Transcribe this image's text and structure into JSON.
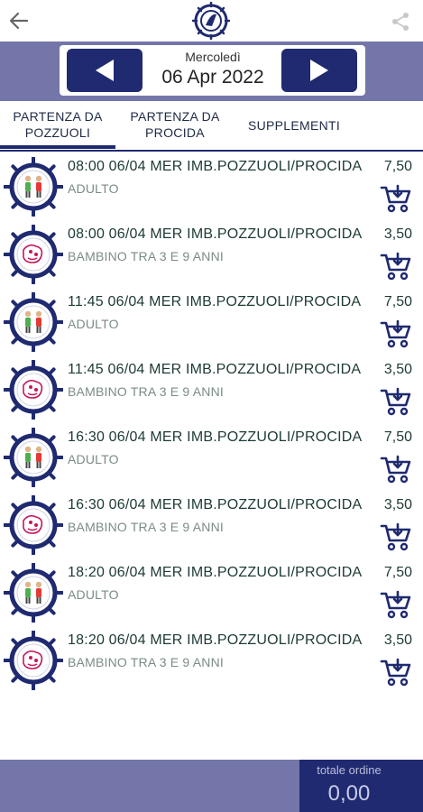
{
  "header": {
    "back_icon": "arrow-left-icon",
    "logo": "ferry-company-logo",
    "share_icon": "share-icon"
  },
  "date_nav": {
    "day_name": "Mercoledì",
    "date": "06 Apr 2022",
    "prev_icon": "triangle-left-icon",
    "next_icon": "triangle-right-icon"
  },
  "tabs": [
    {
      "line1": "PARTENZA DA",
      "line2": "POZZUOLI",
      "selected": true
    },
    {
      "line1": "PARTENZA DA",
      "line2": "PROCIDA",
      "selected": false
    },
    {
      "line1": "SUPPLEMENTI",
      "line2": "",
      "selected": false
    }
  ],
  "tickets": [
    {
      "title": "08:00 06/04 MER IMB.POZZUOLI/PROCIDA",
      "type": "ADULTO",
      "price": "7,50",
      "icon": "adult-ticket-icon"
    },
    {
      "title": "08:00 06/04 MER IMB.POZZUOLI/PROCIDA",
      "type": "BAMBINO TRA 3 E 9 ANNI",
      "price": "3,50",
      "icon": "child-ticket-icon"
    },
    {
      "title": "11:45 06/04 MER IMB.POZZUOLI/PROCIDA",
      "type": "ADULTO",
      "price": "7,50",
      "icon": "adult-ticket-icon"
    },
    {
      "title": "11:45 06/04 MER IMB.POZZUOLI/PROCIDA",
      "type": "BAMBINO TRA 3 E 9 ANNI",
      "price": "3,50",
      "icon": "child-ticket-icon"
    },
    {
      "title": "16:30 06/04 MER IMB.POZZUOLI/PROCIDA",
      "type": "ADULTO",
      "price": "7,50",
      "icon": "adult-ticket-icon"
    },
    {
      "title": "16:30 06/04 MER IMB.POZZUOLI/PROCIDA",
      "type": "BAMBINO TRA 3 E 9 ANNI",
      "price": "3,50",
      "icon": "child-ticket-icon"
    },
    {
      "title": "18:20 06/04 MER IMB.POZZUOLI/PROCIDA",
      "type": "ADULTO",
      "price": "7,50",
      "icon": "adult-ticket-icon"
    },
    {
      "title": "18:20 06/04 MER IMB.POZZUOLI/PROCIDA",
      "type": "BAMBINO TRA 3 E 9 ANNI",
      "price": "3,50",
      "icon": "child-ticket-icon"
    }
  ],
  "footer": {
    "total_label": "totale ordine",
    "total_value": "0,00"
  },
  "colors": {
    "primary": "#1f2a70",
    "bar": "#7476aa",
    "text": "#1d3a36",
    "subtext": "#7a8c86"
  }
}
